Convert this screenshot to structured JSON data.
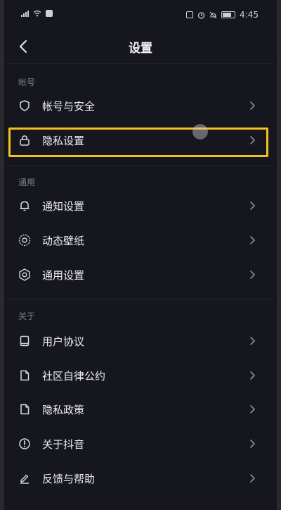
{
  "status_bar": {
    "time": "4:45"
  },
  "header": {
    "title": "设置"
  },
  "sections": [
    {
      "label": "帐号",
      "items": [
        {
          "label": "帐号与安全",
          "icon": "shield-icon"
        },
        {
          "label": "隐私设置",
          "icon": "lock-icon"
        }
      ]
    },
    {
      "label": "通用",
      "items": [
        {
          "label": "通知设置",
          "icon": "bell-icon"
        },
        {
          "label": "动态壁纸",
          "icon": "wallpaper-icon"
        },
        {
          "label": "通用设置",
          "icon": "gear-icon"
        }
      ]
    },
    {
      "label": "关于",
      "items": [
        {
          "label": "用户协议",
          "icon": "book-icon"
        },
        {
          "label": "社区自律公约",
          "icon": "document-icon"
        },
        {
          "label": "隐私政策",
          "icon": "document-icon"
        },
        {
          "label": "关于抖音",
          "icon": "info-icon"
        },
        {
          "label": "反馈与帮助",
          "icon": "edit-icon"
        }
      ]
    }
  ],
  "colors": {
    "background": "#16161f",
    "highlight": "#f2c21a",
    "text": "#ececf1",
    "muted": "#7d7d88"
  }
}
